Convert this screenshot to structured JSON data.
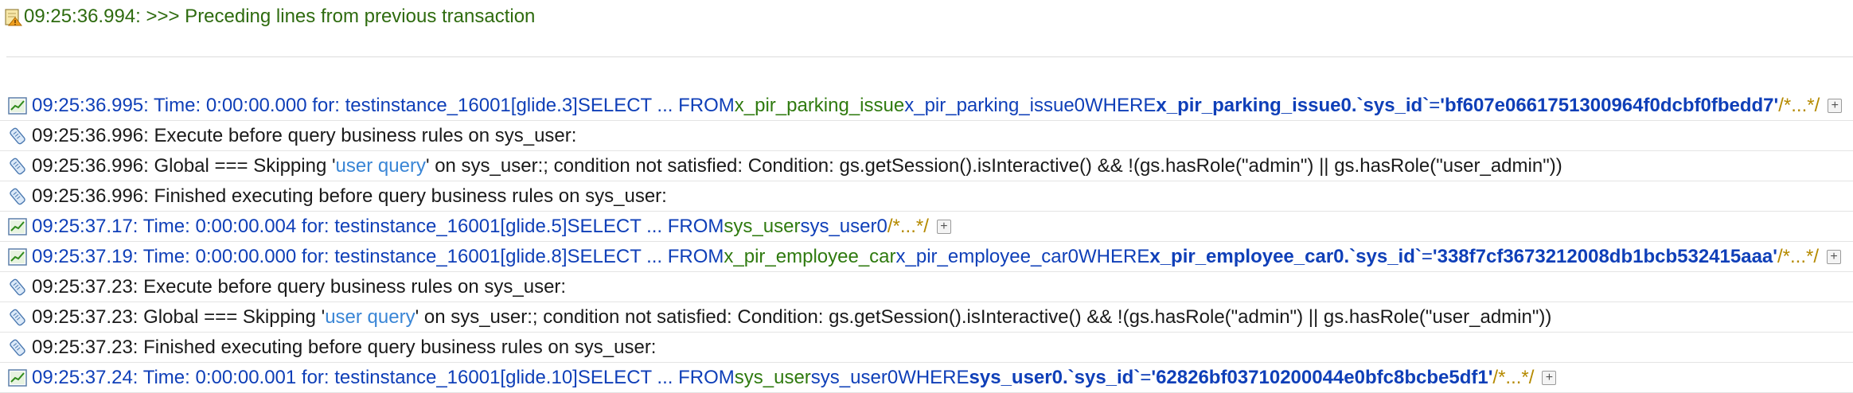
{
  "header": {
    "prev_text": "09:25:36.994: >>> Preceding lines from previous transaction"
  },
  "rows": [
    {
      "type": "sql",
      "icon": "chart-icon",
      "prefix": "09:25:36.995: Time: 0:00:00.000 for: testinstance_16001[glide.3]",
      "select": "SELECT ... FROM",
      "table": "x_pir_parking_issue",
      "alias": "x_pir_parking_issue0",
      "where": "WHERE",
      "column": "x_pir_parking_issue0.`sys_id`",
      "eq": "=",
      "value": "'bf607e0661751300964f0dcbf0fbedd7'",
      "comment": "/*...*/",
      "expand": "+"
    },
    {
      "type": "rule",
      "icon": "scroll-icon",
      "text": "09:25:36.996: Execute before query business rules on sys_user:"
    },
    {
      "type": "skip",
      "icon": "scroll-icon",
      "pre": "09:25:36.996: Global === Skipping '",
      "link": "user query",
      "post": "' on sys_user:; condition not satisfied: Condition: gs.getSession().isInteractive() && !(gs.hasRole(\"admin\") || gs.hasRole(\"user_admin\"))"
    },
    {
      "type": "rule",
      "icon": "scroll-icon",
      "text": "09:25:36.996: Finished executing before query business rules on sys_user:"
    },
    {
      "type": "sql-short",
      "icon": "chart-icon",
      "prefix": "09:25:37.17: Time: 0:00:00.004 for: testinstance_16001[glide.5]",
      "select": "SELECT ... FROM",
      "table": "sys_user",
      "alias": "sys_user0",
      "comment": "/*...*/",
      "expand": "+"
    },
    {
      "type": "sql",
      "icon": "chart-icon",
      "prefix": "09:25:37.19: Time: 0:00:00.000 for: testinstance_16001[glide.8]",
      "select": "SELECT ... FROM",
      "table": "x_pir_employee_car",
      "alias": "x_pir_employee_car0",
      "where": "WHERE",
      "column": "x_pir_employee_car0.`sys_id`",
      "eq": "=",
      "value": "'338f7cf3673212008db1bcb532415aaa'",
      "comment": "/*...*/",
      "expand": "+"
    },
    {
      "type": "rule",
      "icon": "scroll-icon",
      "text": "09:25:37.23: Execute before query business rules on sys_user:"
    },
    {
      "type": "skip",
      "icon": "scroll-icon",
      "pre": "09:25:37.23: Global === Skipping '",
      "link": "user query",
      "post": "' on sys_user:; condition not satisfied: Condition: gs.getSession().isInteractive() && !(gs.hasRole(\"admin\") || gs.hasRole(\"user_admin\"))"
    },
    {
      "type": "rule",
      "icon": "scroll-icon",
      "text": "09:25:37.23: Finished executing before query business rules on sys_user:"
    },
    {
      "type": "sql",
      "icon": "chart-icon",
      "prefix": "09:25:37.24: Time: 0:00:00.001 for: testinstance_16001[glide.10]",
      "select": "SELECT ... FROM",
      "table": "sys_user",
      "alias": "sys_user0",
      "where": "WHERE",
      "column": "sys_user0.`sys_id`",
      "eq": "=",
      "value": "'62826bf03710200044e0bfc8bcbe5df1'",
      "comment": "/*...*/",
      "expand": "+"
    }
  ],
  "colors": {
    "sql": "#0f3fb8",
    "table": "#2f7a0f",
    "comment": "#b58a00",
    "link": "#3a86d6",
    "previous": "#2e6b0f"
  }
}
